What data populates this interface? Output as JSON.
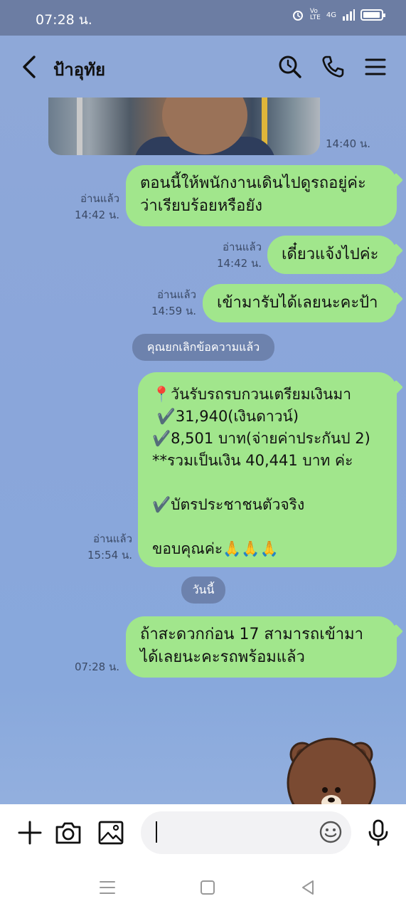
{
  "status_bar": {
    "time": "07:28 น.",
    "network": "4G"
  },
  "header": {
    "title": "ป้าอุทัย"
  },
  "messages": [
    {
      "type": "photo",
      "time": "14:40 น."
    },
    {
      "type": "text",
      "read": "อ่านแล้ว",
      "time": "14:42 น.",
      "lines": [
        "ตอนนี้ให้พนักงานเดินไปดูรถอยู่ค่ะ",
        "ว่าเรียบร้อยหรือยัง"
      ]
    },
    {
      "type": "text",
      "read": "อ่านแล้ว",
      "time": "14:42 น.",
      "lines": [
        "เดี๋ยวแจ้งไปค่ะ"
      ]
    },
    {
      "type": "text",
      "read": "อ่านแล้ว",
      "time": "14:59 น.",
      "lines": [
        "เข้ามารับได้เลยนะคะป้า"
      ]
    },
    {
      "type": "system",
      "text": "คุณยกเลิกข้อความแล้ว"
    },
    {
      "type": "text",
      "read": "อ่านแล้ว",
      "time": "15:54 น.",
      "lines": [
        "📍วันรับรถรบกวนเตรียมเงินมา",
        " ✔️31,940(เงินดาวน์)",
        "✔️8,501 บาท(จ่ายค่าประกันป 2)",
        "**รวมเป็นเงิน 40,441 บาท ค่ะ",
        "",
        "✔️บัตรประชาชนตัวจริง",
        "",
        "ขอบคุณค่ะ🙏🙏🙏"
      ]
    },
    {
      "type": "date",
      "text": "วันนี้"
    },
    {
      "type": "text",
      "time": "07:28 น.",
      "lines": [
        "ถ้าสะดวกก่อน 17 สามารถเข้ามา",
        "ได้เลยนะคะรถพร้อมแล้ว"
      ]
    }
  ],
  "input": {
    "value": "",
    "placeholder": ""
  },
  "colors": {
    "bubble": "#a1e68c",
    "background": "#8aa6da",
    "status_bar": "#6c7da3"
  }
}
